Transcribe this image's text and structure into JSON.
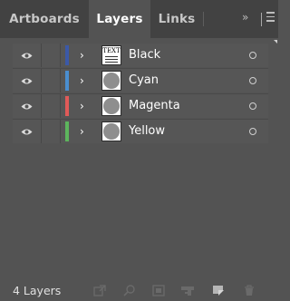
{
  "tabs": [
    {
      "label": "Artboards",
      "active": false
    },
    {
      "label": "Layers",
      "active": true
    },
    {
      "label": "Links",
      "active": false
    }
  ],
  "tab_controls": {
    "expand_glyph": "»",
    "menu_icon": "hamburger-menu-icon"
  },
  "layers": [
    {
      "name": "Black",
      "color": "#3b59a8",
      "thumbnail": "text-document",
      "thumb_text": "TEXT",
      "visible": true,
      "expanded": false
    },
    {
      "name": "Cyan",
      "color": "#4a8ed0",
      "thumbnail": "circle",
      "visible": true,
      "expanded": false
    },
    {
      "name": "Magenta",
      "color": "#e05a58",
      "thumbnail": "circle",
      "visible": true,
      "expanded": false
    },
    {
      "name": "Yellow",
      "color": "#5db55d",
      "thumbnail": "circle",
      "visible": true,
      "expanded": false
    }
  ],
  "footer": {
    "layer_count": "4 Layers",
    "icons": [
      "export-for-screens-icon",
      "locate-object-icon",
      "clipping-mask-icon",
      "new-sublayer-icon",
      "new-layer-icon",
      "delete-icon"
    ]
  },
  "colors": {
    "panel_bg": "#535353",
    "tabbar_bg": "#424242",
    "text": "#ffffff",
    "disabled_icon": "#6a6a6a"
  }
}
